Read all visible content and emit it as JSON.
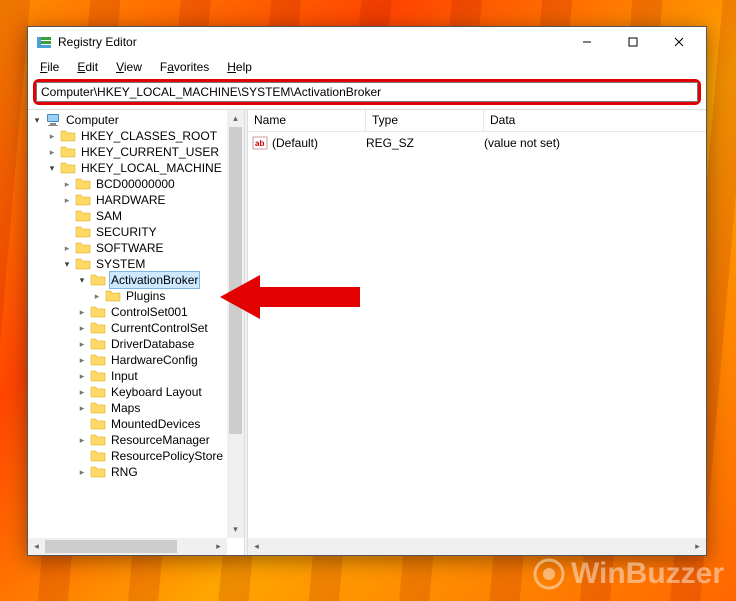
{
  "window": {
    "title": "Registry Editor",
    "controls": {
      "min": "—",
      "max": "☐",
      "close": "✕"
    }
  },
  "menu": {
    "file": "File",
    "edit": "Edit",
    "view": "View",
    "favorites": "Favorites",
    "help": "Help",
    "file_u": "F",
    "edit_u": "E",
    "view_u": "V",
    "favorites_u": "a",
    "help_u": "H"
  },
  "address": "Computer\\HKEY_LOCAL_MACHINE\\SYSTEM\\ActivationBroker",
  "tree": {
    "root": "Computer",
    "hives": {
      "hkcr": "HKEY_CLASSES_ROOT",
      "hkcu": "HKEY_CURRENT_USER",
      "hklm": "HKEY_LOCAL_MACHINE"
    },
    "hklm_children": [
      "BCD00000000",
      "HARDWARE",
      "SAM",
      "SECURITY",
      "SOFTWARE",
      "SYSTEM"
    ],
    "system_children": {
      "activationbroker": "ActivationBroker",
      "plugins": "Plugins",
      "rest": [
        "ControlSet001",
        "CurrentControlSet",
        "DriverDatabase",
        "HardwareConfig",
        "Input",
        "Keyboard Layout",
        "Maps",
        "MountedDevices",
        "ResourceManager",
        "ResourcePolicyStore",
        "RNG"
      ]
    }
  },
  "list": {
    "columns": {
      "name": "Name",
      "type": "Type",
      "data": "Data"
    },
    "rows": [
      {
        "name": "(Default)",
        "type": "REG_SZ",
        "data": "(value not set)"
      }
    ]
  },
  "watermark": "WinBuzzer"
}
